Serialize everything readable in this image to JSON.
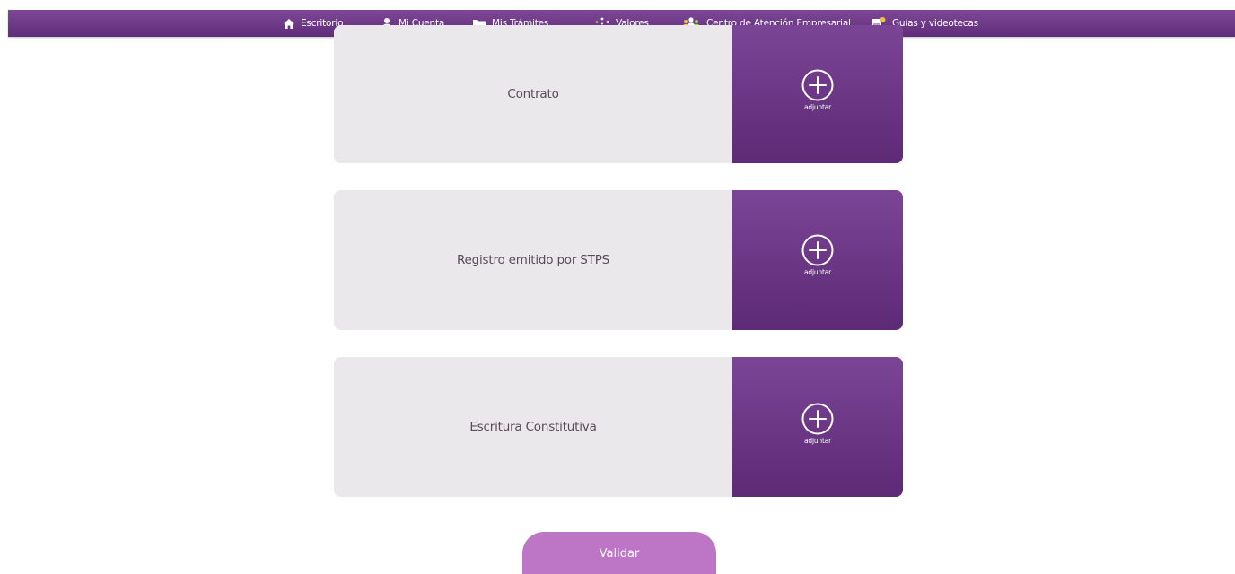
{
  "nav": {
    "items": [
      {
        "label": "Escritorio",
        "icon": "home-icon"
      },
      {
        "label": "Mi Cuenta",
        "icon": "user-icon"
      },
      {
        "label": "Mis Trámites",
        "icon": "folder-icon"
      },
      {
        "label": "Valores",
        "icon": "sparkle-icon"
      },
      {
        "label": "Centro de Atención Empresarial",
        "icon": "users-icon"
      },
      {
        "label": "Guías y videotecas",
        "icon": "guide-icon"
      }
    ]
  },
  "documents": [
    {
      "label": "Contrato",
      "action": "adjuntar",
      "icon": "plus-circle-icon"
    },
    {
      "label": "Registro emitido por STPS",
      "action": "adjuntar",
      "icon": "plus-circle-icon"
    },
    {
      "label": "Escritura Constitutiva",
      "action": "adjuntar",
      "icon": "plus-circle-icon"
    }
  ],
  "validate_button": {
    "label": "Validar"
  },
  "colors": {
    "nav_purple": "#6d3888",
    "panel_purple": "#6b3586",
    "card_bg": "#ebe8ec",
    "button_pink": "#bd75c5"
  }
}
